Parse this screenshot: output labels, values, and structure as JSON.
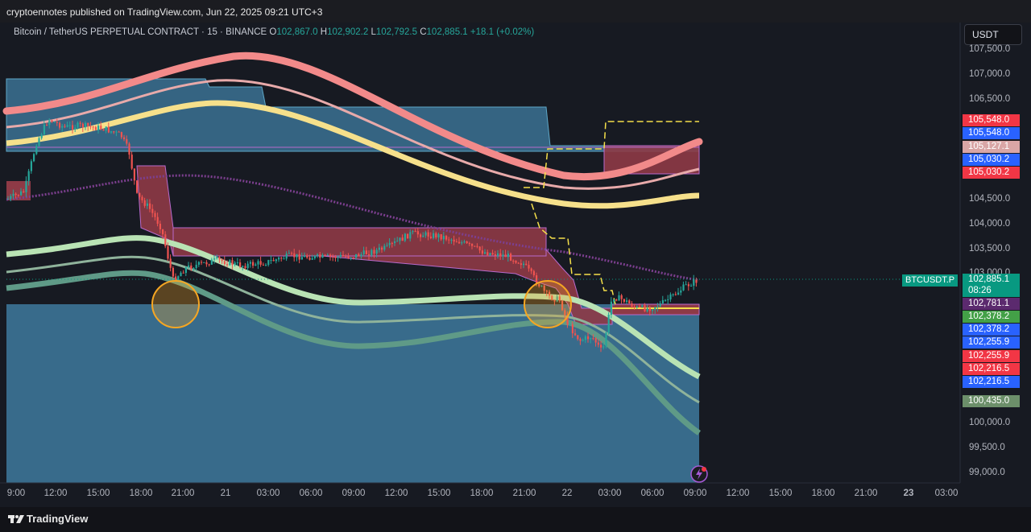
{
  "header": {
    "publish_line": "cryptoennotes published on TradingView.com, Jun 22, 2025 09:21 UTC+3"
  },
  "legend": {
    "symbol": "Bitcoin / TetherUS PERPETUAL CONTRACT · 15 · BINANCE",
    "o_label": "O",
    "o_value": "102,867.0",
    "h_label": "H",
    "h_value": "102,902.2",
    "l_label": "L",
    "l_value": "102,792.5",
    "c_label": "C",
    "c_value": "102,885.1",
    "change": "+18.1 (+0.02%)"
  },
  "currency_button": "USDT",
  "y_axis_ticks": [
    "107,500.0",
    "107,000.0",
    "106,500.0",
    "104,500.0",
    "104,000.0",
    "103,500.0",
    "103,000.0",
    "100,000.0",
    "99,500.0",
    "99,000.0"
  ],
  "x_axis_ticks": [
    "9:00",
    "12:00",
    "15:00",
    "18:00",
    "21:00",
    "21",
    "03:00",
    "06:00",
    "09:00",
    "12:00",
    "15:00",
    "18:00",
    "21:00",
    "22",
    "03:00",
    "06:00",
    "09:00",
    "12:00",
    "15:00",
    "18:00",
    "21:00",
    "23",
    "03:00"
  ],
  "price_tags": [
    {
      "text": "105,548.0",
      "color": "#f23645"
    },
    {
      "text": "105,548.0",
      "color": "#2962ff"
    },
    {
      "text": "105,127.1",
      "color": "#d9a6a6"
    },
    {
      "text": "105,030.2",
      "color": "#2962ff"
    },
    {
      "text": "105,030.2",
      "color": "#f23645"
    },
    {
      "text": "102,781.1",
      "color": "#5b2a6e"
    },
    {
      "text": "102,378.2",
      "color": "#43a047"
    },
    {
      "text": "102,378.2",
      "color": "#2962ff"
    },
    {
      "text": "102,255.9",
      "color": "#2962ff"
    },
    {
      "text": "102,255.9",
      "color": "#f23645"
    },
    {
      "text": "102,216.5",
      "color": "#f23645"
    },
    {
      "text": "102,216.5",
      "color": "#2962ff"
    },
    {
      "text": "100,435.0",
      "color": "#6c8f6a"
    }
  ],
  "current_price": {
    "symbol": "BTCUSDT.P",
    "price": "102,885.1",
    "countdown": "08:26",
    "color": "#089981"
  },
  "footer": {
    "brand": "TradingView"
  },
  "colors": {
    "bull": "#26a69a",
    "bear": "#ef5350",
    "blue_zone": "#3e7a9e",
    "red_zone": "#8e3a46",
    "band_pink": "#f28a8a",
    "band_yellow": "#f6e08b",
    "band_green": "#b9e3b4",
    "circle": "#f5a623",
    "yellow_step": "#f5e04a"
  },
  "icons": [
    "tradingview-logo-icon",
    "lightning-bolt-icon"
  ]
}
